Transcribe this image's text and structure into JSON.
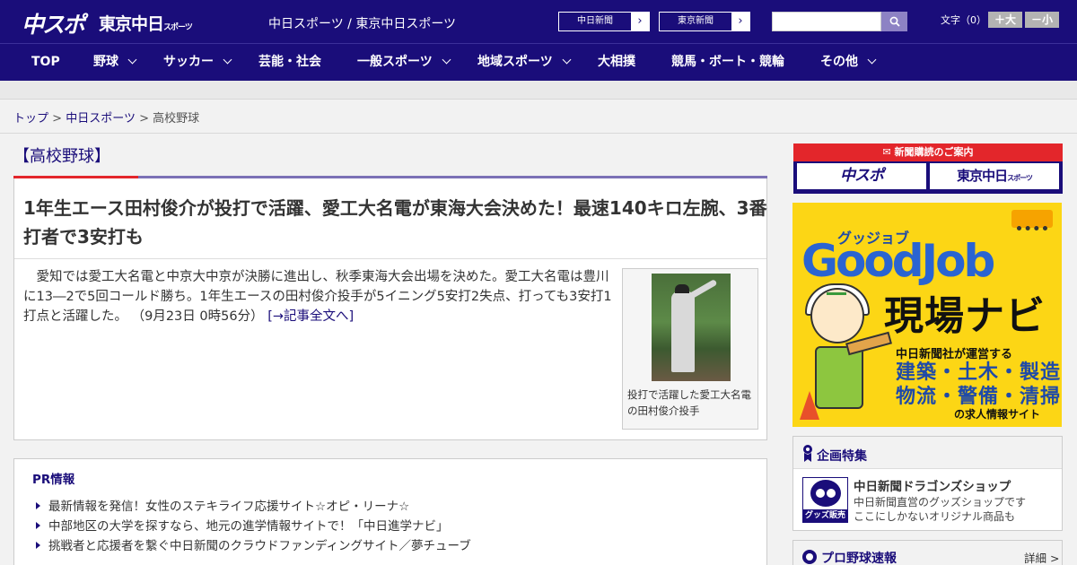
{
  "header": {
    "logo_chuspo": "中スポ",
    "logo_tokyo": "東京中日",
    "logo_tokyo_small": "スポーツ",
    "site_names": "中日スポーツ / 東京中日スポーツ",
    "ext_links": [
      {
        "label": "中日新聞",
        "arrow": "›"
      },
      {
        "label": "東京新聞",
        "arrow": "›"
      }
    ],
    "search_placeholder": "",
    "font_size_label": "文字（0）",
    "font_larger": "＋大",
    "font_smaller": "－小"
  },
  "nav": {
    "items": [
      {
        "label": "TOP",
        "dropdown": false
      },
      {
        "label": "野球",
        "dropdown": true
      },
      {
        "label": "サッカー",
        "dropdown": true
      },
      {
        "label": "芸能・社会",
        "dropdown": false
      },
      {
        "label": "一般スポーツ",
        "dropdown": true
      },
      {
        "label": "地域スポーツ",
        "dropdown": true
      },
      {
        "label": "大相撲",
        "dropdown": false
      },
      {
        "label": "競馬・ボート・競輪",
        "dropdown": false
      },
      {
        "label": "その他",
        "dropdown": true
      }
    ]
  },
  "breadcrumb": {
    "top": "トップ",
    "sep": ">",
    "parent": "中日スポーツ",
    "current": "高校野球"
  },
  "article": {
    "section": "【高校野球】",
    "headline": "1年生エース田村俊介が投打で活躍、愛工大名電が東海大会決めた！最速140キロ左腕、3番打者で3安打も",
    "lead": "愛知では愛工大名電と中京大中京が決勝に進出し、秋季東海大会出場を決めた。愛工大名電は豊川に13―2で5回コールド勝ち。1年生エースの田村俊介投手が5イニング5安打2失点、打っても3安打1打点と活躍した。",
    "timestamp": "（9月23日 0時56分）",
    "more_link": "[→記事全文へ]",
    "photo_caption": "投打で活躍した愛工大名電の田村俊介投手"
  },
  "pr": {
    "title": "PR情報",
    "items": [
      "最新情報を発信！女性のステキライフ応援サイト☆オピ・リーナ☆",
      "中部地区の大学を探すなら、地元の進学情報サイトで！「中日進学ナビ」",
      "挑戦者と応援者を繋ぐ中日新聞のクラウドファンディングサイト／夢チューブ"
    ]
  },
  "side": {
    "subscribe_title": "新聞購読のご案内",
    "subscribe_logo_a": "中スポ",
    "subscribe_logo_b": "東京中日",
    "subscribe_logo_b_small": "スポーツ",
    "goodjob": {
      "kana": "グッジョブ",
      "logo": "GoodJob",
      "navi": "現場ナビ",
      "operator": "中日新聞社が運営する",
      "jobs_line1": "建築・土木・製造",
      "jobs_line2": "物流・警備・清掃",
      "site": "の求人情報サイト"
    },
    "feature": {
      "title": "企画特集",
      "shop_badge": "グッズ販売中",
      "shop_name": "中日新聞ドラゴンズショップ",
      "shop_desc1": "中日新聞直営のグッズショップです",
      "shop_desc2": "ここにしかないオリジナル商品も"
    },
    "baseball": {
      "title": "プロ野球速報",
      "more": "詳細 >"
    }
  },
  "colors": {
    "brand_navy": "#1a0d7a",
    "accent_red": "#e3262b",
    "goodjob_yellow": "#fcd615"
  }
}
